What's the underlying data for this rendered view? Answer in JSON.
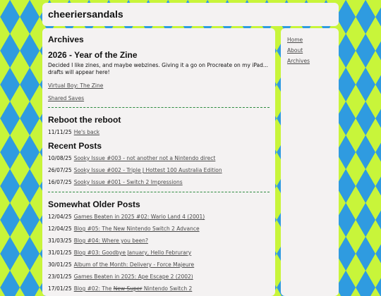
{
  "header": {
    "site_title": "cheeriersandals"
  },
  "main": {
    "archives_title": "Archives",
    "zine": {
      "title": "2026 - Year of the Zine",
      "body": "Decided I like zines, and maybe webzines. Giving it a go on Procreate on my iPad... drafts will appear here!",
      "links": [
        "Virtual Boy: The Zine",
        "Shared Saves"
      ]
    },
    "reboot": {
      "title": "Reboot the reboot",
      "posts": [
        {
          "date": "11/11/25",
          "title": "He's back"
        }
      ]
    },
    "recent": {
      "title": "Recent Posts",
      "posts": [
        {
          "date": "10/08/25",
          "title": "Sooky Issue #003 - not another not a Nintendo direct"
        },
        {
          "date": "26/07/25",
          "title": "Sooky Issue #002 - Triple J Hottest 100 Australia Edition"
        },
        {
          "date": "16/07/25",
          "title": "Sooky Issue #001 - Switch 2 Impressions"
        }
      ]
    },
    "older": {
      "title": "Somewhat Older Posts",
      "posts": [
        {
          "date": "12/04/25",
          "title": "Games Beaten in 2025 #02: Wario Land 4 (2001)"
        },
        {
          "date": "12/04/25",
          "title": "Blog #05: The New Nintendo Switch 2 Advance"
        },
        {
          "date": "31/03/25",
          "title": "Blog #04: Where you been?"
        },
        {
          "date": "31/01/25",
          "title": "Blog #03: Goodbye January, Hello Februrary"
        },
        {
          "date": "30/01/25",
          "title": "Album of the Month: Delivery - Force Majeure"
        },
        {
          "date": "23/01/25",
          "title": "Games Beaten in 2025: Ape Escape 2 (2002)"
        },
        {
          "date": "17/01/25",
          "title_pre": "Blog #02: The ",
          "title_strike": "New Super",
          "title_post": " Nintendo Switch 2"
        }
      ]
    }
  },
  "sidebar": {
    "links": [
      "Home",
      "About",
      "Archives"
    ]
  }
}
